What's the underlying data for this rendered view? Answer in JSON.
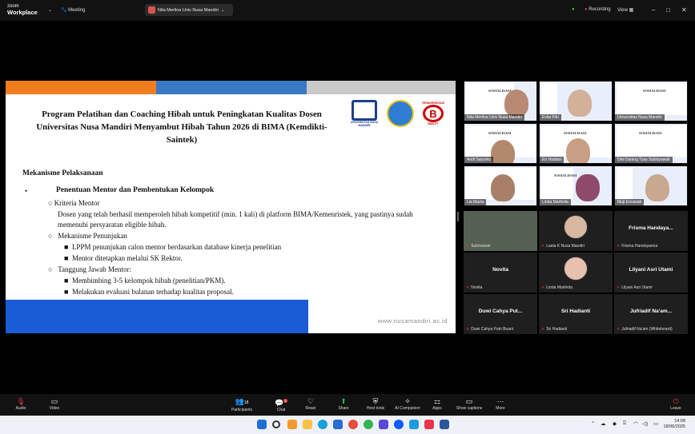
{
  "titlebar": {
    "app_line1": "zoom",
    "app_line2": "Workplace",
    "meeting_label": "Meeting",
    "share_label": "Nita Merlina Univ Nusa Mandiri",
    "recording_label": "Recording",
    "view_label": "View"
  },
  "slide": {
    "title": "Program Pelatihan dan Coaching Hibah untuk Peningkatan Kualitas Dosen Universitas Nusa Mandiri Menyambut Hibah Tahun 2026 di BIMA (Kemdikti-Saintek)",
    "logos": {
      "unm": "UNIVERSITAS NUSA MANDIRI",
      "badge": "TERAKREDITASI",
      "badge_letter": "B",
      "badge_sub": "BAN-PT"
    },
    "section": "Mekanisme Pelaksanaan",
    "bullet_main": "Penentuan Mentor dan Pembentukan Kelompok",
    "sub1": "Kriteria Mentor",
    "sub1_text": "Dosen yang telah berhasil memperoleh hibah kompetitif (min. 1 kali) di platform BIMA/Kemenristek, yang pastinya sudah memenuhi persyaratan eligible hibah.",
    "sub2": "Mekanisme Penunjukan",
    "sub2_items": [
      "LPPM penunjukan calon mentor berdasarkan database kinerja penelitian",
      "Mentor ditetapkan melalui SK Rektor."
    ],
    "sub3": "Tanggung Jawab Mentor:",
    "sub3_items": [
      "Membimbing 3-5 kelompok hibah (penelitian/PKM).",
      "Melakukan evaluasi bulanan terhadap kualitas proposal."
    ],
    "url": "www.nusamandiri.ac.id"
  },
  "video_tiles": [
    {
      "name": "Nita Merlina Univ Nusa Mandiri"
    },
    {
      "name": "Evita Fitri"
    },
    {
      "name": "Universitas Nusa Mandiri"
    },
    {
      "name": "Andi Saryoko"
    },
    {
      "name": "Eri Hadiani"
    },
    {
      "name": "Dini Daning Tyas Sulistyowati"
    },
    {
      "name": "Lia Mazia"
    },
    {
      "name": "Linda Marlinda"
    },
    {
      "name": "Muji Ernawati"
    }
  ],
  "tile_slide_title": "SOSIALISASI",
  "participants": [
    {
      "display": "",
      "label": "Sukmawati"
    },
    {
      "display": "",
      "label": "Laela K Nusa Mandiri"
    },
    {
      "display": "Frisma  Handaya...",
      "label": "Frisma Handayanna"
    },
    {
      "display": "Novita",
      "label": "Novita"
    },
    {
      "display": "",
      "label": "Linda Marlinda"
    },
    {
      "display": "Lilyani Asri Utami",
      "label": "Lilyani Asri Utami"
    },
    {
      "display": "Duwi Cahya Put...",
      "label": "Duwi Cahya Putri Buani"
    },
    {
      "display": "Sri Hadianti",
      "label": "Sri Hadianti"
    },
    {
      "display": "Jufriadif Na'am...",
      "label": "Jufriadif Na'am (Whiteboard)"
    }
  ],
  "controls": {
    "audio": "Audio",
    "video": "Video",
    "participants": "Participants",
    "participants_count": "18",
    "chat": "Chat",
    "chat_badge": "3",
    "react": "React",
    "share": "Share",
    "host_tools": "Host tools",
    "ai_companion": "AI Companion",
    "apps": "Apps",
    "show_captions": "Show captions",
    "more": "More",
    "leave": "Leave"
  },
  "taskbar": {
    "time": "14:08",
    "date": "18/06/2025"
  },
  "colors": {
    "bar_orange": "#f07d1e",
    "bar_blue": "#3a78c2",
    "bar_gray": "#c9c9c9",
    "footer_blue": "#1a5bd6",
    "recording_red": "#e53935"
  }
}
